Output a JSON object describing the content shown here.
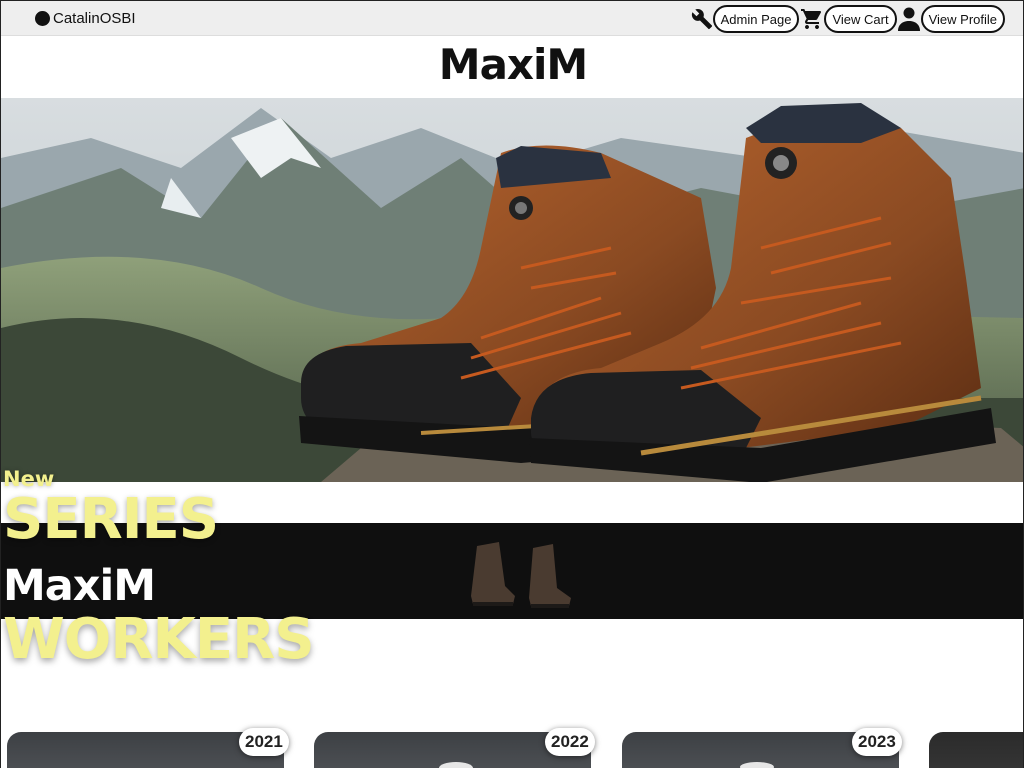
{
  "header": {
    "username": "CatalinOSBI",
    "admin_label": "Admin Page",
    "cart_label": "View Cart",
    "profile_label": "View Profile"
  },
  "brand": {
    "name": "MaxiM"
  },
  "promo": {
    "new": "New",
    "series": "SERIES",
    "maxim": "MaxiM",
    "workers": "WORKERS"
  },
  "collections": [
    {
      "year": "2021"
    },
    {
      "year": "2022"
    },
    {
      "year": "2023"
    }
  ],
  "icons": {
    "admin": "wrench-icon",
    "cart": "cart-icon",
    "profile": "user-icon",
    "avatar": "avatar-dot-icon"
  },
  "colors": {
    "accent_yellow": "#f3f08e",
    "band_black": "#0f0f0f",
    "topbar_gray": "#eeeeee",
    "boot_brown": "#8a4a22"
  }
}
